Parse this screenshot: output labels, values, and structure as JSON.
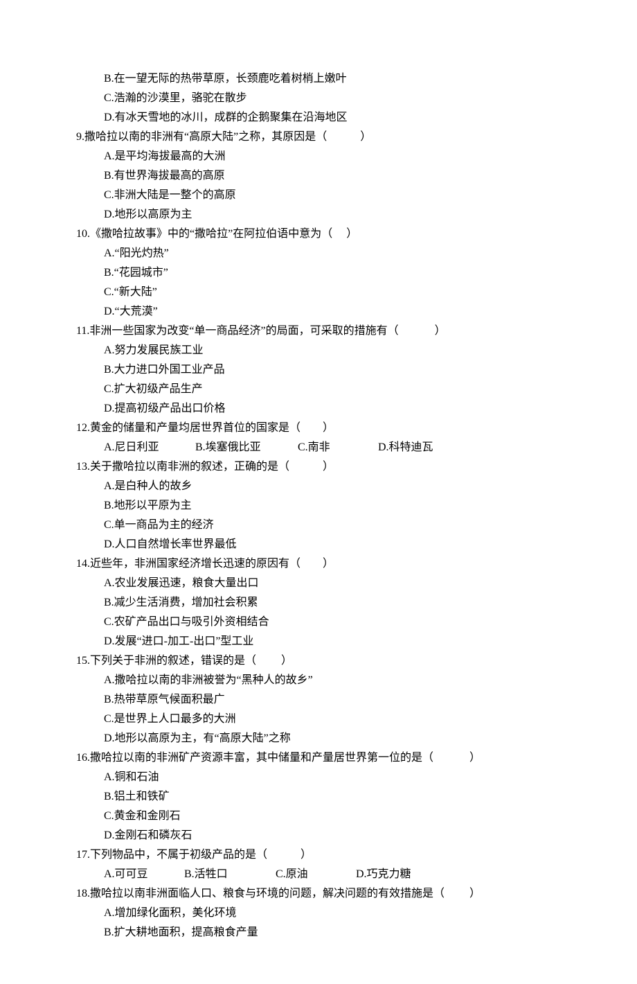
{
  "q8": {
    "B": "B.在一望无际的热带草原，长颈鹿吃着树梢上嫩叶",
    "C": "C.浩瀚的沙漠里，骆驼在散步",
    "D": "D.有冰天雪地的冰川，成群的企鹅聚集在沿海地区"
  },
  "q9": {
    "stem": "9.撒哈拉以南的非洲有“高原大陆”之称，其原因是（　　　）",
    "A": "A.是平均海拔最高的大洲",
    "B": "B.有世界海拔最高的高原",
    "C": "C.非洲大陆是一整个的高原",
    "D": "D.地形以高原为主"
  },
  "q10": {
    "stem": "10.《撒哈拉故事》中的“撒哈拉”在阿拉伯语中意为（　 ）",
    "A": "A.“阳光灼热”",
    "B": "B.“花园城市”",
    "C": "C.“新大陆”",
    "D": "D.“大荒漠”"
  },
  "q11": {
    "stem": "11.非洲一些国家为改变“单一商品经济”的局面，可采取的措施有（　　　 ）",
    "A": "A.努力发展民族工业",
    "B": "B.大力进口外国工业产品",
    "C": "C.扩大初级产品生产",
    "D": "D.提高初级产品出口价格"
  },
  "q12": {
    "stem": "12.黄金的储量和产量均居世界首位的国家是（　　）",
    "A": "A.尼日利亚",
    "B": "B.埃塞俄比亚",
    "C": "C.南非",
    "D": "D.科特迪瓦"
  },
  "q13": {
    "stem": "13.关于撒哈拉以南非洲的叙述，正确的是（　　　）",
    "A": "A.是白种人的故乡",
    "B": "B.地形以平原为主",
    "C": "C.单一商品为主的经济",
    "D": "D.人口自然增长率世界最低"
  },
  "q14": {
    "stem": "14.近些年，非洲国家经济增长迅速的原因有（　　）",
    "A": "A.农业发展迅速，粮食大量出口",
    "B": "B.减少生活消费，增加社会积累",
    "C": "C.农矿产品出口与吸引外资相结合",
    "D": "D.发展“进口‐加工‐出口”型工业"
  },
  "q15": {
    "stem": "15.下列关于非洲的叙述，错误的是（　　 ）",
    "A": "A.撒哈拉以南的非洲被誉为“黑种人的故乡”",
    "B": "B.热带草原气候面积最广",
    "C": "C.是世界上人口最多的大洲",
    "D": "D.地形以高原为主，有“高原大陆”之称"
  },
  "q16": {
    "stem": "16.撒哈拉以南的非洲矿产资源丰富，其中储量和产量居世界第一位的是（　　　 ）",
    "A": "A.铜和石油",
    "B": "B.铝土和铁矿",
    "C": "C.黄金和金刚石",
    "D": "D.金刚石和磷灰石"
  },
  "q17": {
    "stem": "17.下列物品中，不属于初级产品的是（　　　）",
    "A": "A.可可豆",
    "B": "B.活牲口",
    "C": "C.原油",
    "D": "D.巧克力糖"
  },
  "q18": {
    "stem": "18.撒哈拉以南非洲面临人口、粮食与环境的问题，解决问题的有效措施是（　　 ）",
    "A": "A.增加绿化面积，美化环境",
    "B": "B.扩大耕地面积，提高粮食产量"
  }
}
